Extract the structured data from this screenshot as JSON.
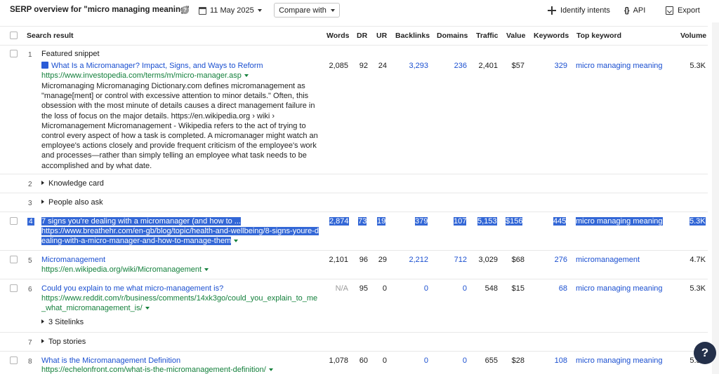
{
  "toolbar": {
    "title": "SERP overview for \"micro managing meaning\"",
    "help_icon": "?",
    "date": "11 May 2025",
    "compare": "Compare with",
    "identify": "Identify intents",
    "api_glyph": "{}",
    "api": "API",
    "export": "Export"
  },
  "columns": {
    "search_result": "Search result",
    "words": "Words",
    "dr": "DR",
    "ur": "UR",
    "backlinks": "Backlinks",
    "domains": "Domains",
    "traffic": "Traffic",
    "value": "Value",
    "keywords": "Keywords",
    "top_keyword": "Top keyword",
    "volume": "Volume"
  },
  "rows": [
    {
      "num": "1",
      "label": "Featured snippet",
      "title": "What Is a Micromanager? Impact, Signs, and Ways to Reform",
      "url": "https://www.investopedia.com/terms/m/micro-manager.asp",
      "snippet": "Micromanaging Micromanaging Dictionary.com defines micromanagement as \"manage[ment] or control with excessive attention to minor details.\" Often, this obsession with the most minute of details causes a direct management failure in the loss of focus on the major details. https://en.wikipedia.org › wiki › Micromanagement Micromanagement - Wikipedia refers to the act of trying to control every aspect of how a task is completed. A micromanager might watch an employee's actions closely and provide frequent criticism of the employee's work and processes—rather than simply telling an employee what task needs to be accomplished and by what date.",
      "words": "2,085",
      "dr": "92",
      "ur": "24",
      "backlinks": "3,293",
      "domains": "236",
      "traffic": "2,401",
      "value": "$57",
      "keywords": "329",
      "top_keyword": "micro managing meaning",
      "volume": "5.3K"
    },
    {
      "num": "2",
      "label": "Knowledge card"
    },
    {
      "num": "3",
      "label": "People also ask"
    },
    {
      "num": "4",
      "title": "7 signs you're dealing with a micromanager (and how to ...",
      "url_line1": "https://www.breathehr.com/en-gb/blog/topic/health-and-wellbeing/8-signs-youre-d",
      "url_line2": "ealing-with-a-micro-manager-and-how-to-manage-them",
      "words": "2,874",
      "dr": "73",
      "ur": "19",
      "backlinks": "379",
      "domains": "107",
      "traffic": "5,153",
      "value": "$156",
      "keywords": "445",
      "top_keyword": "micro managing meaning",
      "volume": "5.3K"
    },
    {
      "num": "5",
      "title": "Micromanagement",
      "url": "https://en.wikipedia.org/wiki/Micromanagement",
      "words": "2,101",
      "dr": "96",
      "ur": "29",
      "backlinks": "2,212",
      "domains": "712",
      "traffic": "3,029",
      "value": "$68",
      "keywords": "276",
      "top_keyword": "micromanagement",
      "volume": "4.7K"
    },
    {
      "num": "6",
      "title": "Could you explain to me what micro-management is?",
      "url_line1": "https://www.reddit.com/r/business/comments/14xk3go/could_you_explain_to_me",
      "url_line2": "_what_micromanagement_is/",
      "sitelinks": "3 Sitelinks",
      "words": "N/A",
      "dr": "95",
      "ur": "0",
      "backlinks": "0",
      "domains": "0",
      "traffic": "548",
      "value": "$15",
      "keywords": "68",
      "top_keyword": "micro managing meaning",
      "volume": "5.3K"
    },
    {
      "num": "7",
      "label": "Top stories"
    },
    {
      "num": "8",
      "title": "What is the Micromanagement Definition",
      "url": "https://echelonfront.com/what-is-the-micromanagement-definition/",
      "words": "1,078",
      "dr": "60",
      "ur": "0",
      "backlinks": "0",
      "domains": "0",
      "traffic": "655",
      "value": "$28",
      "keywords": "108",
      "top_keyword": "micro managing meaning",
      "volume": "5.3K"
    }
  ],
  "help_bubble": "?",
  "colors": {
    "link": "#1a4fd0",
    "url": "#14803c",
    "selection": "#3367d6",
    "help_bubble": "#24304a"
  }
}
